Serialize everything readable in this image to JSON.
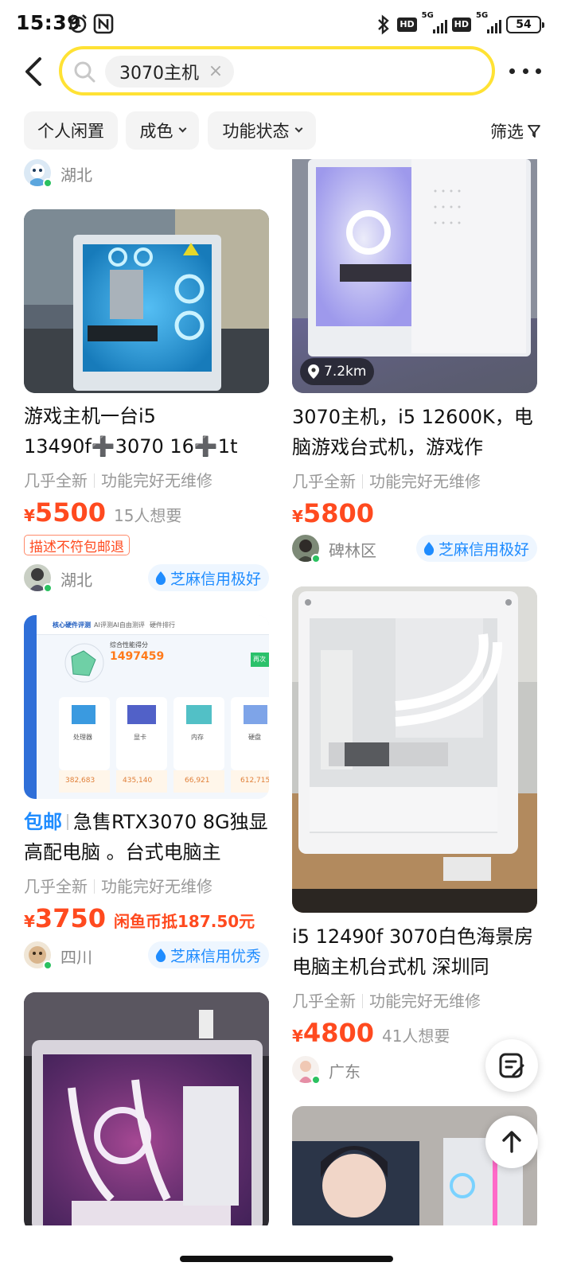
{
  "status_bar": {
    "time": "15:39",
    "network_1": "5G",
    "network_2": "5G",
    "hd_1": "HD",
    "hd_2": "HD",
    "battery": "54"
  },
  "header": {
    "search_chip": "3070主机",
    "clear_icon": "×"
  },
  "filters": {
    "items": [
      "个人闲置",
      "成色",
      "功能状态"
    ],
    "filter_label": "筛选"
  },
  "left_column": {
    "top_seller_location": "湖北",
    "items": [
      {
        "title": "游戏主机一台i5 13490f➕3070  16➕1t",
        "condition": "几乎全新",
        "function": "功能完好无维修",
        "currency": "¥",
        "price": "5500",
        "wants": "15人想要",
        "warn_tag": "描述不符包邮退",
        "location": "湖北",
        "credit": "芝麻信用极好"
      },
      {
        "baoyou": "包邮",
        "title": "急售RTX3070 8G独显高配电脑 。台式电脑主",
        "condition": "几乎全新",
        "function": "功能完好无维修",
        "currency": "¥",
        "price": "3750",
        "coin": "闲鱼币抵187.50元",
        "location": "四川",
        "credit": "芝麻信用优秀",
        "image_text": {
          "tab_1": "核心硬件评测",
          "tab_2": "AI评测",
          "tab_3": "AI自由测评",
          "tab_4": "硬件排行",
          "score_label": "综合性能得分",
          "score": "1497459",
          "cpu_label": "处理器",
          "gpu_label": "显卡",
          "ram_label": "内存",
          "disk_label": "硬盘",
          "cpu_score": "382,683",
          "gpu_score": "435,140",
          "ram_score": "66,921",
          "disk_score": "612,715",
          "button": "再次"
        }
      }
    ]
  },
  "right_column": {
    "items": [
      {
        "distance": "7.2km",
        "title": "3070主机，i5 12600K，电脑游戏台式机，游戏作",
        "condition": "几乎全新",
        "function": "功能完好无维修",
        "currency": "¥",
        "price": "5800",
        "location": "碑林区",
        "credit": "芝麻信用极好"
      },
      {
        "title": "i5 12490f 3070白色海景房电脑主机台式机 深圳同",
        "condition": "几乎全新",
        "function": "功能完好无维修",
        "currency": "¥",
        "price": "4800",
        "wants": "41人想要",
        "location": "广东"
      }
    ]
  },
  "colors": {
    "accent_yellow": "#ffe234",
    "price_orange": "#ff4a1f",
    "credit_blue": "#1f8cff",
    "online_green": "#2bc160"
  }
}
